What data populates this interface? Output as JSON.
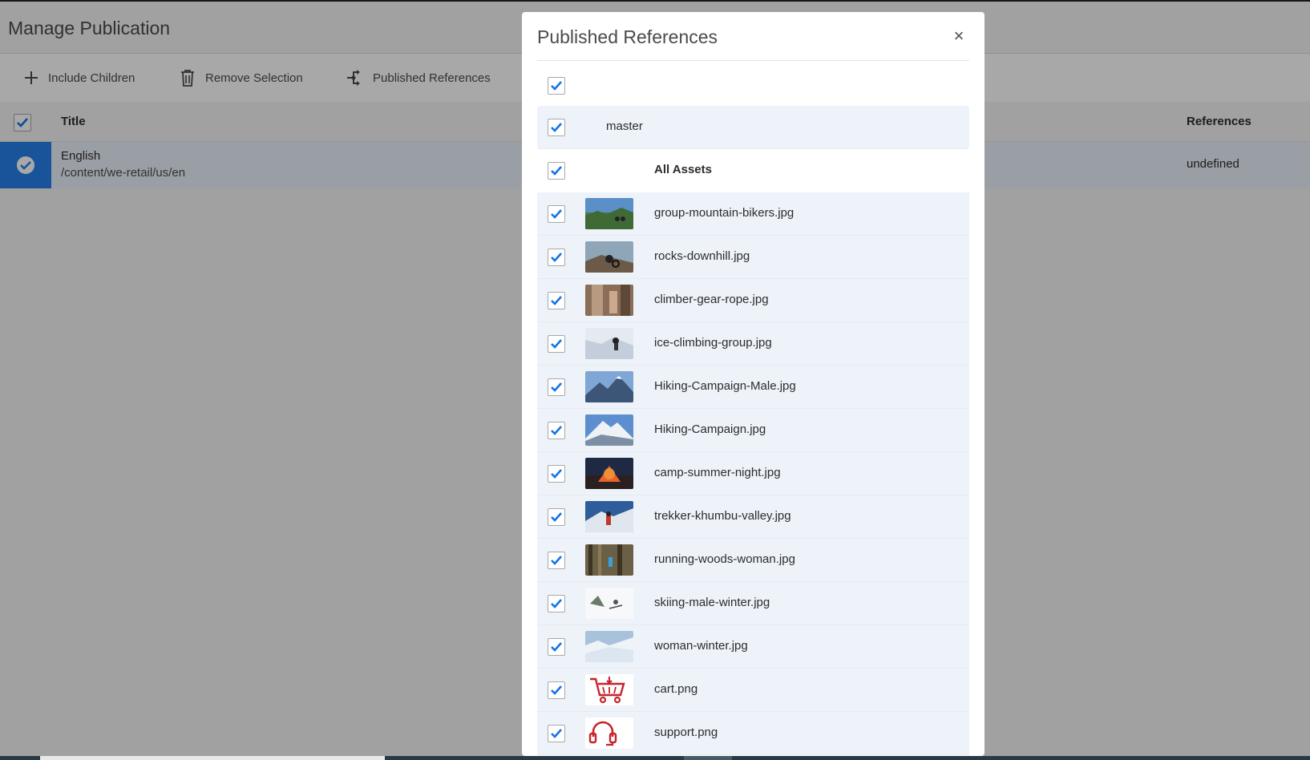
{
  "page": {
    "title": "Manage Publication",
    "toolbar": {
      "include_children": "Include Children",
      "remove_selection": "Remove Selection",
      "published_references": "Published References"
    },
    "table": {
      "headers": {
        "title": "Title",
        "references": "References"
      },
      "rows": [
        {
          "title": "English",
          "path": "/content/we-retail/us/en",
          "references": "undefined",
          "selected": true
        }
      ]
    }
  },
  "dialog": {
    "title": "Published References",
    "close_label": "×",
    "master_label": "master",
    "all_assets_label": "All Assets",
    "assets": [
      {
        "name": "group-mountain-bikers.jpg",
        "thumb": "bikers-photo"
      },
      {
        "name": "rocks-downhill.jpg",
        "thumb": "downhill-photo"
      },
      {
        "name": "climber-gear-rope.jpg",
        "thumb": "climber-photo"
      },
      {
        "name": "ice-climbing-group.jpg",
        "thumb": "ice-photo"
      },
      {
        "name": "Hiking-Campaign-Male.jpg",
        "thumb": "mountain-photo"
      },
      {
        "name": "Hiking-Campaign.jpg",
        "thumb": "peak-photo"
      },
      {
        "name": "camp-summer-night.jpg",
        "thumb": "camp-photo"
      },
      {
        "name": "trekker-khumbu-valley.jpg",
        "thumb": "trekker-photo"
      },
      {
        "name": "running-woods-woman.jpg",
        "thumb": "woods-photo"
      },
      {
        "name": "skiing-male-winter.jpg",
        "thumb": "ski-photo"
      },
      {
        "name": "woman-winter.jpg",
        "thumb": "snow-photo"
      },
      {
        "name": "cart.png",
        "thumb": "cart-icon"
      },
      {
        "name": "support.png",
        "thumb": "headset-icon"
      }
    ]
  },
  "colors": {
    "accent": "#2680eb",
    "check": "#1473e6",
    "icon_red": "#c8222a"
  }
}
